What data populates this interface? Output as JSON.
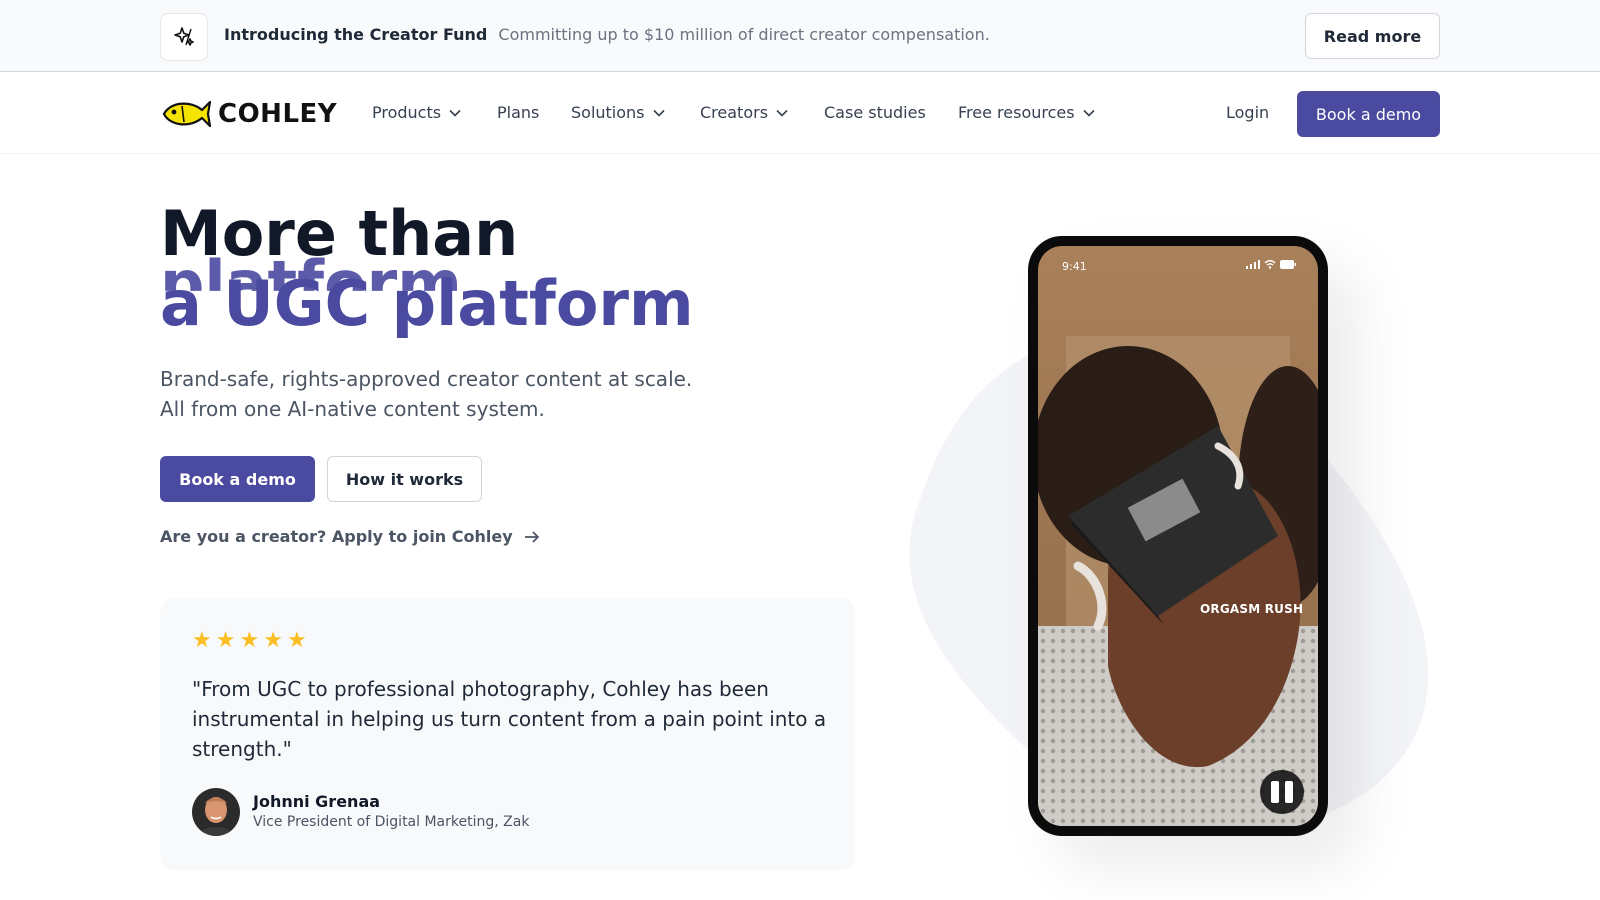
{
  "announcement": {
    "title": "Introducing the Creator Fund",
    "text": "Committing up to $10 million of direct creator compensation.",
    "button": "Read more",
    "icon": "sparkle-icon"
  },
  "nav": {
    "logo": "COHLEY",
    "items": [
      {
        "label": "Products",
        "dropdown": true
      },
      {
        "label": "Plans",
        "dropdown": false
      },
      {
        "label": "Solutions",
        "dropdown": true
      },
      {
        "label": "Creators",
        "dropdown": true
      },
      {
        "label": "Case studies",
        "dropdown": false
      },
      {
        "label": "Free resources",
        "dropdown": true
      }
    ],
    "login": "Login",
    "cta": "Book a demo"
  },
  "hero": {
    "line1": "More than",
    "ghost": "platform",
    "line2": "a UGC platform",
    "subtitle_line1": "Brand-safe, rights-approved creator content at scale.",
    "subtitle_line2": "All from one AI-native content system.",
    "primary_button": "Book a demo",
    "secondary_button": "How it works",
    "creator_link": "Are you a creator? Apply to join Cohley"
  },
  "testimonial": {
    "rating": 5,
    "quote": "\"From UGC to professional photography, Cohley has been instrumental in helping us turn content from a pain point into a strength.\"",
    "author": "Johnni Grenaa",
    "role": "Vice President of Digital Marketing, Zak"
  },
  "phone": {
    "time": "9:41",
    "overlay": "ORGASM RUSH",
    "control": "pause-icon"
  },
  "colors": {
    "brand": "#4a4aa0",
    "star": "#fbbf24",
    "logo_fish": "#f5e300"
  }
}
